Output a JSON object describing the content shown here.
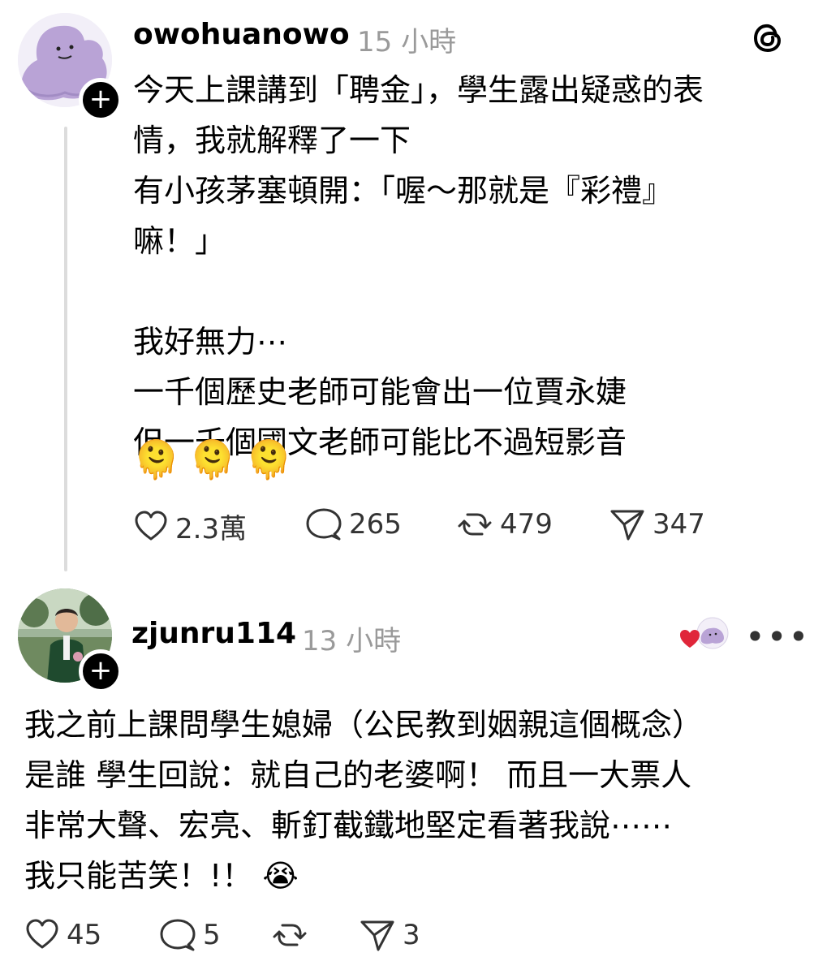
{
  "post": {
    "username": "owohuanowo",
    "time": "15 小時",
    "follow_symbol": "+",
    "text_lines": [
      "今天上課講到「聘金」，學生露出疑惑的表",
      "情，我就解釋了一下",
      "有小孩茅塞頓開：「喔～那就是『彩禮』",
      "嘛！」",
      "",
      "我好無力⋯",
      "一千個歷史老師可能會出一位賈永婕",
      "但一千個國文老師可能比不過短影音"
    ],
    "emojis": [
      "🫠",
      "🫠",
      "🫠"
    ],
    "actions": {
      "likes": "2.3萬",
      "comments": "265",
      "reposts": "479",
      "shares": "347"
    }
  },
  "reply": {
    "username": "zjunru114",
    "time": "13 小時",
    "follow_symbol": "+",
    "more_label": "•••",
    "text_lines": [
      "我之前上課問學生媳婦（公民教到姻親這個概念）",
      "是誰 學生回說：就自己的老婆啊！  而且一大票人",
      "非常大聲、宏亮、斬釘截鐵地堅定看著我說⋯⋯",
      "我只能苦笑！!！  😭"
    ],
    "actions": {
      "likes": "45",
      "comments": "5",
      "reposts": "",
      "shares": "3"
    }
  },
  "icons": {
    "threads_logo": "threads-logo-icon",
    "heart": "heart-icon",
    "comment": "comment-bubble-icon",
    "repost": "repost-icon",
    "share": "send-icon"
  },
  "colors": {
    "text": "#000000",
    "muted": "#9a9a9a",
    "thread_line": "#dcdcdc",
    "liked_heart": "#e0263a"
  }
}
